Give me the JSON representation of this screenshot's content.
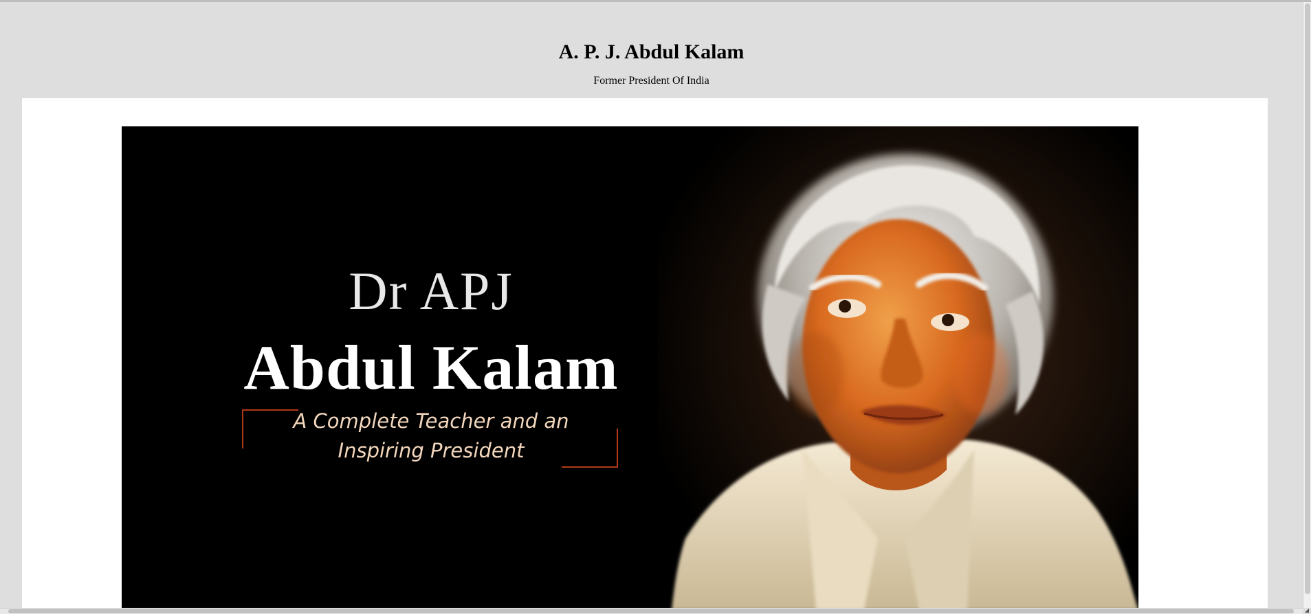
{
  "header": {
    "title": "A. P. J. Abdul Kalam",
    "subtitle": "Former President Of India"
  },
  "hero": {
    "line1": "Dr APJ",
    "line2": "Abdul Kalam",
    "tagline": [
      "A Complete Teacher and an",
      "Inspiring President"
    ],
    "image_alt": "Painted portrait of Dr APJ Abdul Kalam"
  },
  "colors": {
    "page_bg": "#dedede",
    "card_bg": "#ffffff",
    "hero_bg": "#000000",
    "accent_bracket": "#b13a18",
    "tagline": "#f3d7bd"
  }
}
